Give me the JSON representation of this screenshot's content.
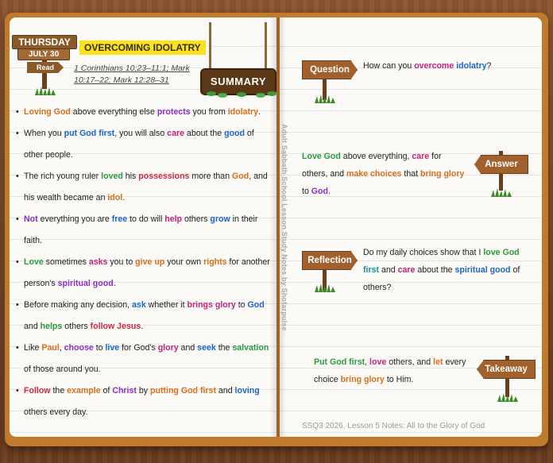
{
  "header": {
    "day": "THURSDAY",
    "date": "JULY 30",
    "read_label": "Read",
    "title": "OVERCOMING IDOLATRY",
    "references": "1 Corinthians 10:23–11:1; Mark 10:17–22; Mark 12:28–31",
    "summary_label": "SUMMARY"
  },
  "side_text": "Adult Sabbath School Lesson Study Notes by Shofarpulse",
  "bullets": [
    [
      {
        "t": "Loving God",
        "c": "ob"
      },
      {
        "t": " above everything else "
      },
      {
        "t": "protects",
        "c": "pu"
      },
      {
        "t": " you from "
      },
      {
        "t": "idolatry",
        "c": "ob"
      },
      {
        "t": "."
      }
    ],
    [
      {
        "t": "When you "
      },
      {
        "t": "put God first",
        "c": "bl"
      },
      {
        "t": ", you will also "
      },
      {
        "t": "care",
        "c": "mg"
      },
      {
        "t": " about the "
      },
      {
        "t": "good",
        "c": "bl"
      },
      {
        "t": " of other people."
      }
    ],
    [
      {
        "t": "The rich young ruler "
      },
      {
        "t": "loved",
        "c": "gr"
      },
      {
        "t": " his "
      },
      {
        "t": "possessions",
        "c": "rd"
      },
      {
        "t": " more than "
      },
      {
        "t": "God",
        "c": "ob"
      },
      {
        "t": ", and his wealth became an "
      },
      {
        "t": "idol",
        "c": "ob"
      },
      {
        "t": "."
      }
    ],
    [
      {
        "t": "Not",
        "c": "pu"
      },
      {
        "t": " everything you are "
      },
      {
        "t": "free",
        "c": "bl"
      },
      {
        "t": " to do will "
      },
      {
        "t": "help",
        "c": "mg"
      },
      {
        "t": " others "
      },
      {
        "t": "grow",
        "c": "bl"
      },
      {
        "t": " in their faith."
      }
    ],
    [
      {
        "t": "Love",
        "c": "gr"
      },
      {
        "t": " sometimes "
      },
      {
        "t": "asks",
        "c": "mg"
      },
      {
        "t": " you to "
      },
      {
        "t": "give up",
        "c": "ob"
      },
      {
        "t": " your own "
      },
      {
        "t": "rights",
        "c": "ob"
      },
      {
        "t": " for another person's "
      },
      {
        "t": "spiritual good",
        "c": "pu"
      },
      {
        "t": "."
      }
    ],
    [
      {
        "t": "Before making any decision, "
      },
      {
        "t": "ask",
        "c": "bl"
      },
      {
        "t": " whether it "
      },
      {
        "t": "brings glory",
        "c": "mg"
      },
      {
        "t": " to "
      },
      {
        "t": "God",
        "c": "bl"
      },
      {
        "t": " and "
      },
      {
        "t": "helps",
        "c": "gr"
      },
      {
        "t": " others "
      },
      {
        "t": "follow Jesus",
        "c": "rd"
      },
      {
        "t": "."
      }
    ],
    [
      {
        "t": "Like "
      },
      {
        "t": "Paul",
        "c": "ob"
      },
      {
        "t": ", "
      },
      {
        "t": "choose",
        "c": "pu"
      },
      {
        "t": " to "
      },
      {
        "t": "live",
        "c": "bl"
      },
      {
        "t": " for God's "
      },
      {
        "t": "glory",
        "c": "mg"
      },
      {
        "t": " and "
      },
      {
        "t": "seek",
        "c": "bl"
      },
      {
        "t": " the "
      },
      {
        "t": "salvation",
        "c": "gr"
      },
      {
        "t": " of those around you."
      }
    ],
    [
      {
        "t": "Follow",
        "c": "rd"
      },
      {
        "t": " the "
      },
      {
        "t": "example",
        "c": "ob"
      },
      {
        "t": " of "
      },
      {
        "t": "Christ",
        "c": "pu"
      },
      {
        "t": " by "
      },
      {
        "t": "putting God first",
        "c": "ob"
      },
      {
        "t": " and "
      },
      {
        "t": "loving",
        "c": "bl"
      },
      {
        "t": " others every day."
      }
    ]
  ],
  "right": {
    "question_label": "Question",
    "question": [
      {
        "t": "How can you "
      },
      {
        "t": "overcome",
        "c": "mg"
      },
      {
        "t": " "
      },
      {
        "t": "idolatry",
        "c": "bl"
      },
      {
        "t": "?"
      }
    ],
    "answer_label": "Answer",
    "answer": [
      {
        "t": "Love God",
        "c": "gr"
      },
      {
        "t": " above everything, "
      },
      {
        "t": "care",
        "c": "mg"
      },
      {
        "t": " for others, and "
      },
      {
        "t": "make choices",
        "c": "ob"
      },
      {
        "t": " that "
      },
      {
        "t": "bring glory",
        "c": "ob"
      },
      {
        "t": " to "
      },
      {
        "t": "God",
        "c": "pu"
      },
      {
        "t": "."
      }
    ],
    "reflection_label": "Reflection",
    "reflection": [
      {
        "t": "Do my daily choices show that I "
      },
      {
        "t": "love God",
        "c": "gr"
      },
      {
        "t": " "
      },
      {
        "t": "first",
        "c": "tl"
      },
      {
        "t": " and "
      },
      {
        "t": "care",
        "c": "mg"
      },
      {
        "t": " about the "
      },
      {
        "t": "spiritual good",
        "c": "bl"
      },
      {
        "t": " of others?"
      }
    ],
    "takeaway_label": "Takeaway",
    "takeaway": [
      {
        "t": "Put God first",
        "c": "gr"
      },
      {
        "t": ", "
      },
      {
        "t": "love",
        "c": "mg"
      },
      {
        "t": " others, and "
      },
      {
        "t": "let",
        "c": "ob"
      },
      {
        "t": " every choice "
      },
      {
        "t": "bring glory",
        "c": "ob"
      },
      {
        "t": " to Him."
      }
    ]
  },
  "footer": "SSQ3 2026, Lesson 5 Notes: All to the Glory of God",
  "colors": {
    "orange": "#d96f1d",
    "purple": "#8c2fc9",
    "blue": "#1a67c9",
    "green": "#2a9a3b",
    "red": "#d2293e",
    "magenta": "#c4237a",
    "teal": "#1b8ea8",
    "sign": "#a0612c",
    "highlight": "#f9e31d"
  }
}
